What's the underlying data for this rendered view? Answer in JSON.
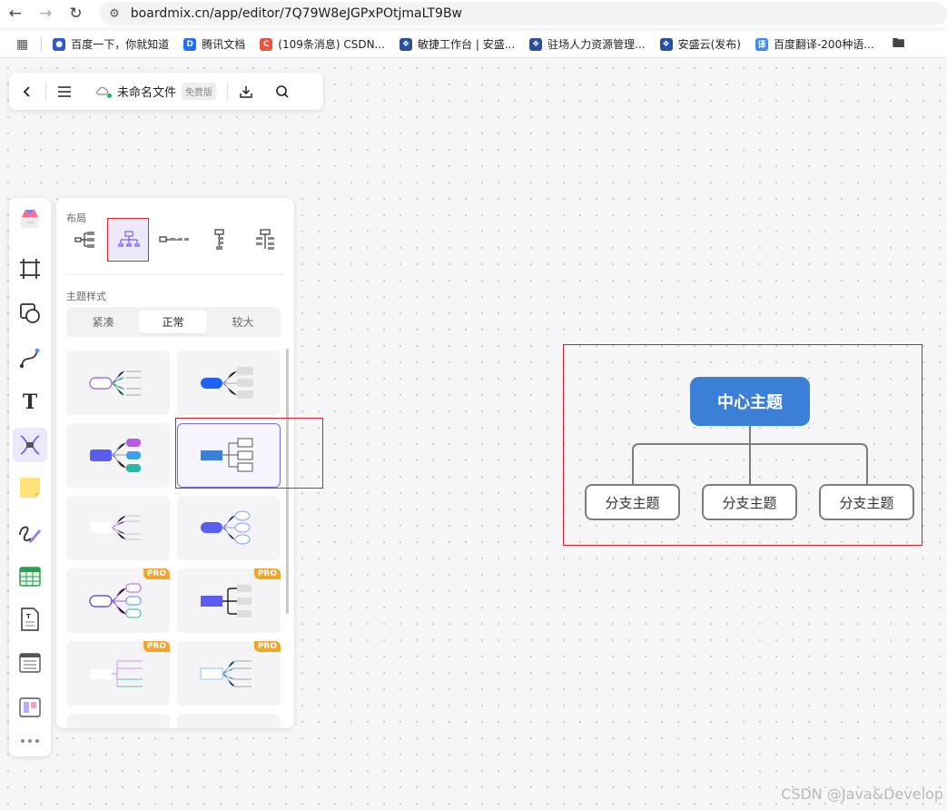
{
  "browser": {
    "url": "boardmix.cn/app/editor/7Q79W8eJGPxPOtjmaLT9Bw",
    "bookmarks": [
      {
        "label": "百度一下，你就知道",
        "icon": "baidu-icon",
        "color": "#2e57d8"
      },
      {
        "label": "腾讯文档",
        "icon": "tencent-docs-icon",
        "color": "#1e6fff"
      },
      {
        "label": "(109条消息) CSDN...",
        "icon": "csdn-icon",
        "color": "#e9543d"
      },
      {
        "label": "敏捷工作台 | 安盛...",
        "icon": "ansheng-icon",
        "color": "#2a4f9e"
      },
      {
        "label": "驻场人力资源管理...",
        "icon": "ansheng-icon",
        "color": "#2a4f9e"
      },
      {
        "label": "安盛云(发布)",
        "icon": "ansheng-icon",
        "color": "#2a4f9e"
      },
      {
        "label": "百度翻译-200种语...",
        "icon": "baidu-translate-icon",
        "color": "#3a8ef0"
      }
    ]
  },
  "file_bar": {
    "file_name": "未命名文件",
    "plan_badge": "免费版"
  },
  "panel": {
    "layout_label": "布局",
    "theme_style_label": "主题样式",
    "density_tabs": [
      "紧凑",
      "正常",
      "较大"
    ],
    "selected_density": "正常",
    "pro_badge": "PRO"
  },
  "mindmap": {
    "center": "中心主题",
    "branches": [
      "分支主题",
      "分支主题",
      "分支主题"
    ],
    "accent_color": "#3b7fd6"
  },
  "watermark": "CSDN @Java&Develop"
}
